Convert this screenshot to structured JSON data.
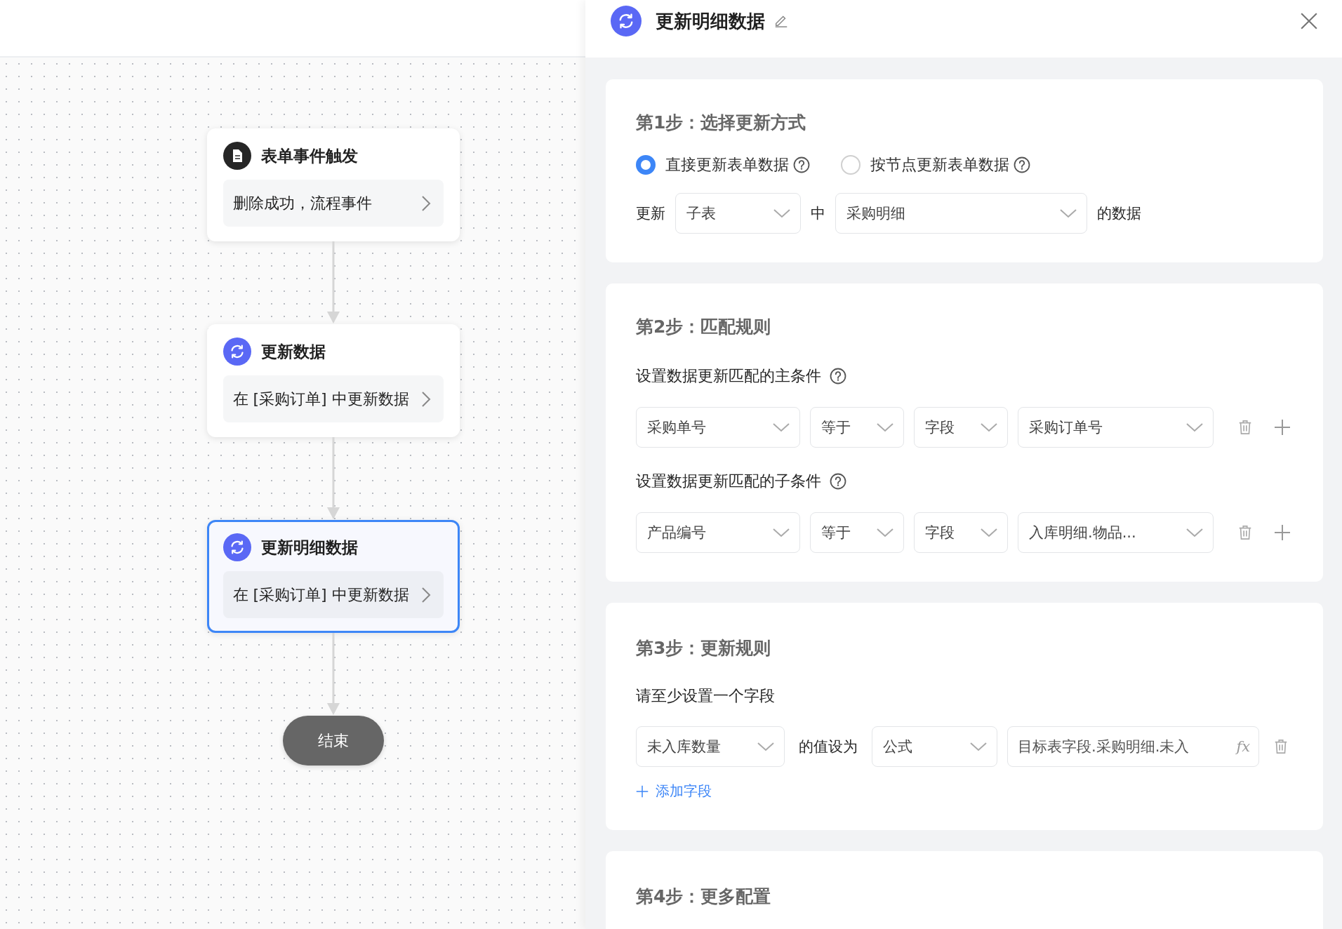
{
  "canvas": {
    "nodes": [
      {
        "kind": "trigger",
        "title": "表单事件触发",
        "summary": "删除成功，流程事件",
        "selected": false
      },
      {
        "kind": "update",
        "title": "更新数据",
        "summary": "在 [采购订单] 中更新数据",
        "selected": false
      },
      {
        "kind": "update",
        "title": "更新明细数据",
        "summary": "在 [采购订单] 中更新数据",
        "selected": true
      }
    ],
    "end_label": "结束"
  },
  "panel": {
    "title": "更新明细数据",
    "steps": [
      {
        "kind": "method",
        "title": "第1步：选择更新方式",
        "options": [
          {
            "label": "直接更新表单数据",
            "selected": true
          },
          {
            "label": "按节点更新表单数据",
            "selected": false
          }
        ],
        "target": {
          "prefix": "更新",
          "table_type": "子表",
          "middle": "中",
          "table": "采购明细",
          "suffix": "的数据"
        }
      },
      {
        "kind": "match",
        "title": "第2步：匹配规则",
        "groups": [
          {
            "label": "设置数据更新匹配的主条件",
            "field": "采购单号",
            "operator": "等于",
            "source": "字段",
            "value": "采购订单号"
          },
          {
            "label": "设置数据更新匹配的子条件",
            "field": "产品编号",
            "operator": "等于",
            "source": "字段",
            "value": "入库明细.物品..."
          }
        ]
      },
      {
        "kind": "rules",
        "title": "第3步：更新规则",
        "hint": "请至少设置一个字段",
        "rules": [
          {
            "field": "未入库数量",
            "connector": "的值设为",
            "mode": "公式",
            "formula": "目标表字段.采购明细.未入",
            "formula_icon": "fx"
          }
        ],
        "add_label": "添加字段"
      },
      {
        "kind": "more",
        "title": "第4步：更多配置"
      }
    ]
  }
}
